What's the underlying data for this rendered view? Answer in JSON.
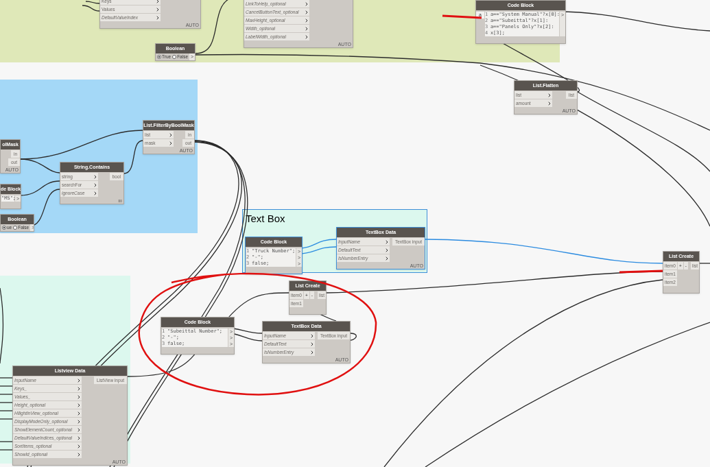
{
  "groups": [
    {
      "kind": "fill",
      "color": "#dfe8b8"
    },
    {
      "kind": "fill",
      "color": "#a4d8f7"
    },
    {
      "kind": "fill",
      "color": "#dcf8ee"
    },
    {
      "kind": "titled",
      "title": "Text Box",
      "selected": true
    }
  ],
  "nodes": [
    {
      "kind": "function",
      "inputs": [
        {
          "label": "Keys",
          "optional": false
        },
        {
          "label": "Values",
          "optional": false
        },
        {
          "label": "DefaultValueIndex",
          "optional": true
        }
      ],
      "footer": "AUTO"
    },
    {
      "kind": "function",
      "inputs": [
        {
          "label": "LinkToHelp_optional",
          "optional": true
        },
        {
          "label": "CancelButtonText_optional",
          "optional": true
        },
        {
          "label": "MaxHeight_optional",
          "optional": true
        },
        {
          "label": "Width_optional",
          "optional": true
        },
        {
          "label": "LabelWidth_optional",
          "optional": true
        }
      ],
      "footer": "AUTO"
    },
    {
      "kind": "boolean",
      "title": "Boolean",
      "options": [
        {
          "label": "True",
          "selected": true
        },
        {
          "label": "False",
          "selected": false
        }
      ],
      "output": ">"
    },
    {
      "kind": "code",
      "title": "Code Block",
      "input": "a",
      "lines": [
        "a==\"System Manual\"?x[0]:",
        "a==\"Subeittal\"?x[1]:",
        "a==\"Panels Only\"?x[2]:",
        "x[3];"
      ],
      "numbers": [
        "1",
        "2",
        "3",
        "4"
      ],
      "outputs": [
        ">"
      ]
    },
    {
      "kind": "function",
      "title": "List.Flatten",
      "inputs": [
        {
          "label": "list",
          "optional": false
        },
        {
          "label": "amount",
          "optional": false
        }
      ],
      "outputs": [
        "list"
      ],
      "footer": "AUTO"
    },
    {
      "kind": "function",
      "title": "olMask",
      "outputs": [
        "in",
        "out"
      ],
      "footer": "AUTO"
    },
    {
      "kind": "code",
      "title": "de Block",
      "lines": [
        "\"MS\";"
      ],
      "outputs": [
        ">"
      ]
    },
    {
      "kind": "boolean",
      "title": "Boolean",
      "options": [
        {
          "label": "ue",
          "selected": true
        },
        {
          "label": "False",
          "selected": false
        }
      ],
      "output": ">"
    },
    {
      "kind": "function",
      "title": "String.Contains",
      "inputs": [
        {
          "label": "string",
          "optional": false
        },
        {
          "label": "searchFor",
          "optional": false
        },
        {
          "label": "ignoreCase",
          "optional": true
        }
      ],
      "outputs": [
        "bool"
      ],
      "footer": "ııı"
    },
    {
      "kind": "function",
      "title": "List.FilterByBoolMask",
      "inputs": [
        {
          "label": "list",
          "optional": false
        },
        {
          "label": "mask",
          "optional": false
        }
      ],
      "outputs": [
        "in",
        "out"
      ],
      "footer": "AUTO"
    },
    {
      "kind": "code",
      "title": "Code Block",
      "lines": [
        "\"Truck Number\";",
        "\"-\";",
        "false;"
      ],
      "numbers": [
        "1",
        "2",
        "3"
      ],
      "outputs": [
        ">",
        ">",
        ">"
      ]
    },
    {
      "kind": "function",
      "title": "TextBox Data",
      "inputs": [
        {
          "label": "InputName",
          "optional": true
        },
        {
          "label": "DefaultText",
          "optional": true
        },
        {
          "label": "IsNumberEntry",
          "optional": true
        }
      ],
      "outputs": [
        "TextBox input"
      ],
      "footer": "AUTO"
    },
    {
      "kind": "listcreate",
      "title": "List Create",
      "items": [
        "item0",
        "item1",
        "item2"
      ],
      "buttons": [
        "+",
        "-"
      ],
      "output": "list"
    },
    {
      "kind": "listcreate",
      "title": "List Create",
      "items": [
        "item0",
        "item1"
      ],
      "buttons": [
        "+",
        "-"
      ],
      "output": "list"
    },
    {
      "kind": "code",
      "title": "Code Block",
      "lines": [
        "\"Subeittal Number\";",
        "\"-\";",
        "false;"
      ],
      "numbers": [
        "1",
        "2",
        "3"
      ],
      "outputs": [
        ">",
        ">",
        ">"
      ]
    },
    {
      "kind": "function",
      "title": "TextBox Data",
      "inputs": [
        {
          "label": "InputName",
          "optional": true
        },
        {
          "label": "DefaultText",
          "optional": true
        },
        {
          "label": "IsNumberEntry",
          "optional": true
        }
      ],
      "outputs": [
        "TextBox input"
      ],
      "footer": "AUTO"
    },
    {
      "kind": "function",
      "title": "Listview Data",
      "inputs": [
        {
          "label": "InputName",
          "optional": true
        },
        {
          "label": "Keys_",
          "optional": true
        },
        {
          "label": "Values_",
          "optional": true
        },
        {
          "label": "Height_optional",
          "optional": true
        },
        {
          "label": "HilightInView_optional",
          "optional": true
        },
        {
          "label": "DisplayModeOnly_optional",
          "optional": true
        },
        {
          "label": "ShowElementCount_optional",
          "optional": true
        },
        {
          "label": "DefaultValueIndices_optional",
          "optional": true
        },
        {
          "label": "SortItems_optional",
          "optional": true
        },
        {
          "label": "ShowId_optional",
          "optional": true
        }
      ],
      "outputs": [
        "ListView input"
      ],
      "footer": "AUTO"
    }
  ]
}
